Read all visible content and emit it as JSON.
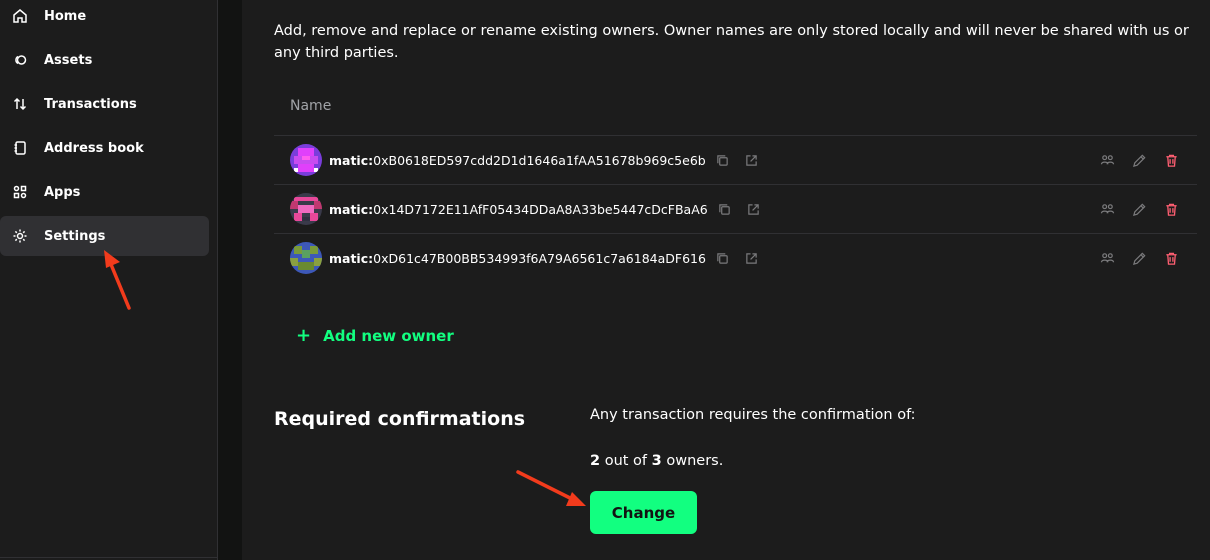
{
  "sidebar": {
    "items": [
      {
        "label": "Home",
        "icon": "home-icon"
      },
      {
        "label": "Assets",
        "icon": "assets-icon"
      },
      {
        "label": "Transactions",
        "icon": "transactions-icon"
      },
      {
        "label": "Address book",
        "icon": "address-book-icon"
      },
      {
        "label": "Apps",
        "icon": "apps-icon"
      },
      {
        "label": "Settings",
        "icon": "settings-icon",
        "active": true
      }
    ]
  },
  "owners": {
    "description": "Add, remove and replace or rename existing owners. Owner names are only stored locally and will never be shared with us or any third parties.",
    "column_header": "Name",
    "rows": [
      {
        "prefix": "matic:",
        "address": "0xB0618ED597cdd2D1d1646a1fAA51678b969c5e6b"
      },
      {
        "prefix": "matic:",
        "address": "0x14D7172E11AfF05434DDaA8A33be5447cDcFBaA6"
      },
      {
        "prefix": "matic:",
        "address": "0xD61c47B00BB534993f6A79A6561c7a6184aDF616"
      }
    ],
    "add_owner_label": "Add new owner"
  },
  "confirmations": {
    "title": "Required confirmations",
    "description": "Any transaction requires the confirmation of:",
    "required": "2",
    "out_of_text": "out of",
    "total": "3",
    "owners_text": "owners.",
    "change_label": "Change"
  },
  "colors": {
    "accent": "#12ff80",
    "danger": "#ff5f72",
    "background": "#1c1c1c"
  }
}
